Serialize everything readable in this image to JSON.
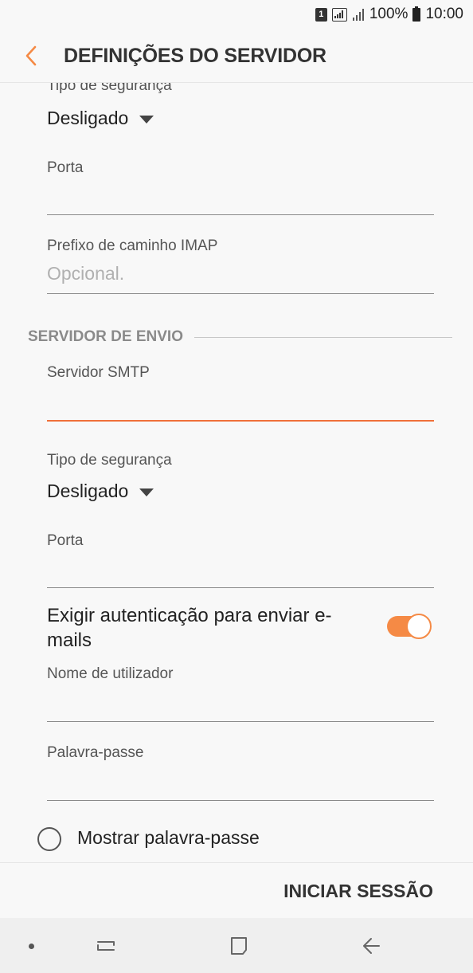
{
  "status_bar": {
    "sim_slot": "1",
    "battery": "100%",
    "time": "10:00"
  },
  "header": {
    "title": "DEFINIÇÕES DO SERVIDOR"
  },
  "incoming": {
    "security_label": "Tipo de segurança",
    "security_value": "Desligado",
    "port_label": "Porta",
    "port_value": "",
    "imap_prefix_label": "Prefixo de caminho IMAP",
    "imap_prefix_placeholder": "Opcional."
  },
  "outgoing": {
    "section_title": "SERVIDOR DE ENVIO",
    "smtp_label": "Servidor SMTP",
    "smtp_value": "",
    "security_label": "Tipo de segurança",
    "security_value": "Desligado",
    "port_label": "Porta",
    "port_value": "",
    "require_auth_label": "Exigir autenticação para enviar e-mails",
    "require_auth_enabled": true,
    "username_label": "Nome de utilizador",
    "password_label": "Palavra-passe",
    "show_password_label": "Mostrar palavra-passe",
    "show_password_checked": false
  },
  "actions": {
    "login_label": "INICIAR SESSÃO"
  },
  "nav_bar": {
    "icons": [
      "dot-icon",
      "recent-apps-icon",
      "home-icon",
      "back-icon"
    ]
  },
  "colors": {
    "accent": "#f58a45",
    "active_underline": "#f0703a"
  }
}
